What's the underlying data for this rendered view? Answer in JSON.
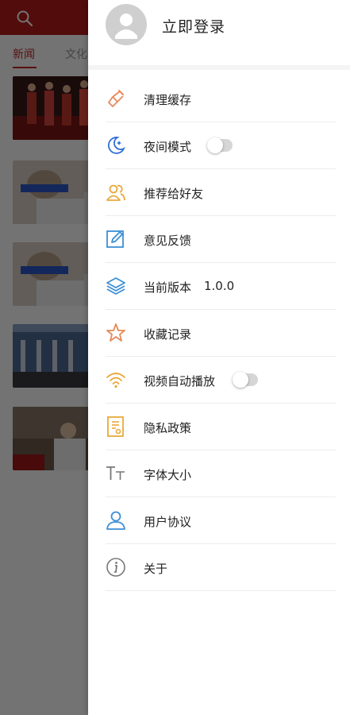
{
  "background": {
    "tabs": [
      {
        "label": "新闻",
        "active": true
      },
      {
        "label": "文化",
        "active": false
      }
    ]
  },
  "drawer": {
    "login_label": "立即登录",
    "menu": [
      {
        "id": "clear-cache",
        "label": "清理缓存",
        "icon": "broom-icon",
        "color": "#e8895a"
      },
      {
        "id": "night-mode",
        "label": "夜间模式",
        "icon": "moon-icon",
        "color": "#2f6fd6",
        "toggle": false
      },
      {
        "id": "recommend",
        "label": "推荐给好友",
        "icon": "users-icon",
        "color": "#e9a93a"
      },
      {
        "id": "feedback",
        "label": "意见反馈",
        "icon": "edit-icon",
        "color": "#3c8fd6"
      },
      {
        "id": "version",
        "label": "当前版本",
        "value": "1.0.0",
        "icon": "layers-icon",
        "color": "#3c8fd6"
      },
      {
        "id": "favorites",
        "label": "收藏记录",
        "icon": "star-icon",
        "color": "#e8895a"
      },
      {
        "id": "autoplay",
        "label": "视频自动播放",
        "icon": "wifi-icon",
        "color": "#e9a93a",
        "toggle": false
      },
      {
        "id": "privacy",
        "label": "隐私政策",
        "icon": "document-icon",
        "color": "#e9a93a"
      },
      {
        "id": "font-size",
        "label": "字体大小",
        "icon": "font-size-icon",
        "color": "#777777"
      },
      {
        "id": "user-agreement",
        "label": "用户协议",
        "icon": "user-icon",
        "color": "#3c8fd6"
      },
      {
        "id": "about",
        "label": "关于",
        "icon": "info-icon",
        "color": "#777777"
      }
    ]
  }
}
